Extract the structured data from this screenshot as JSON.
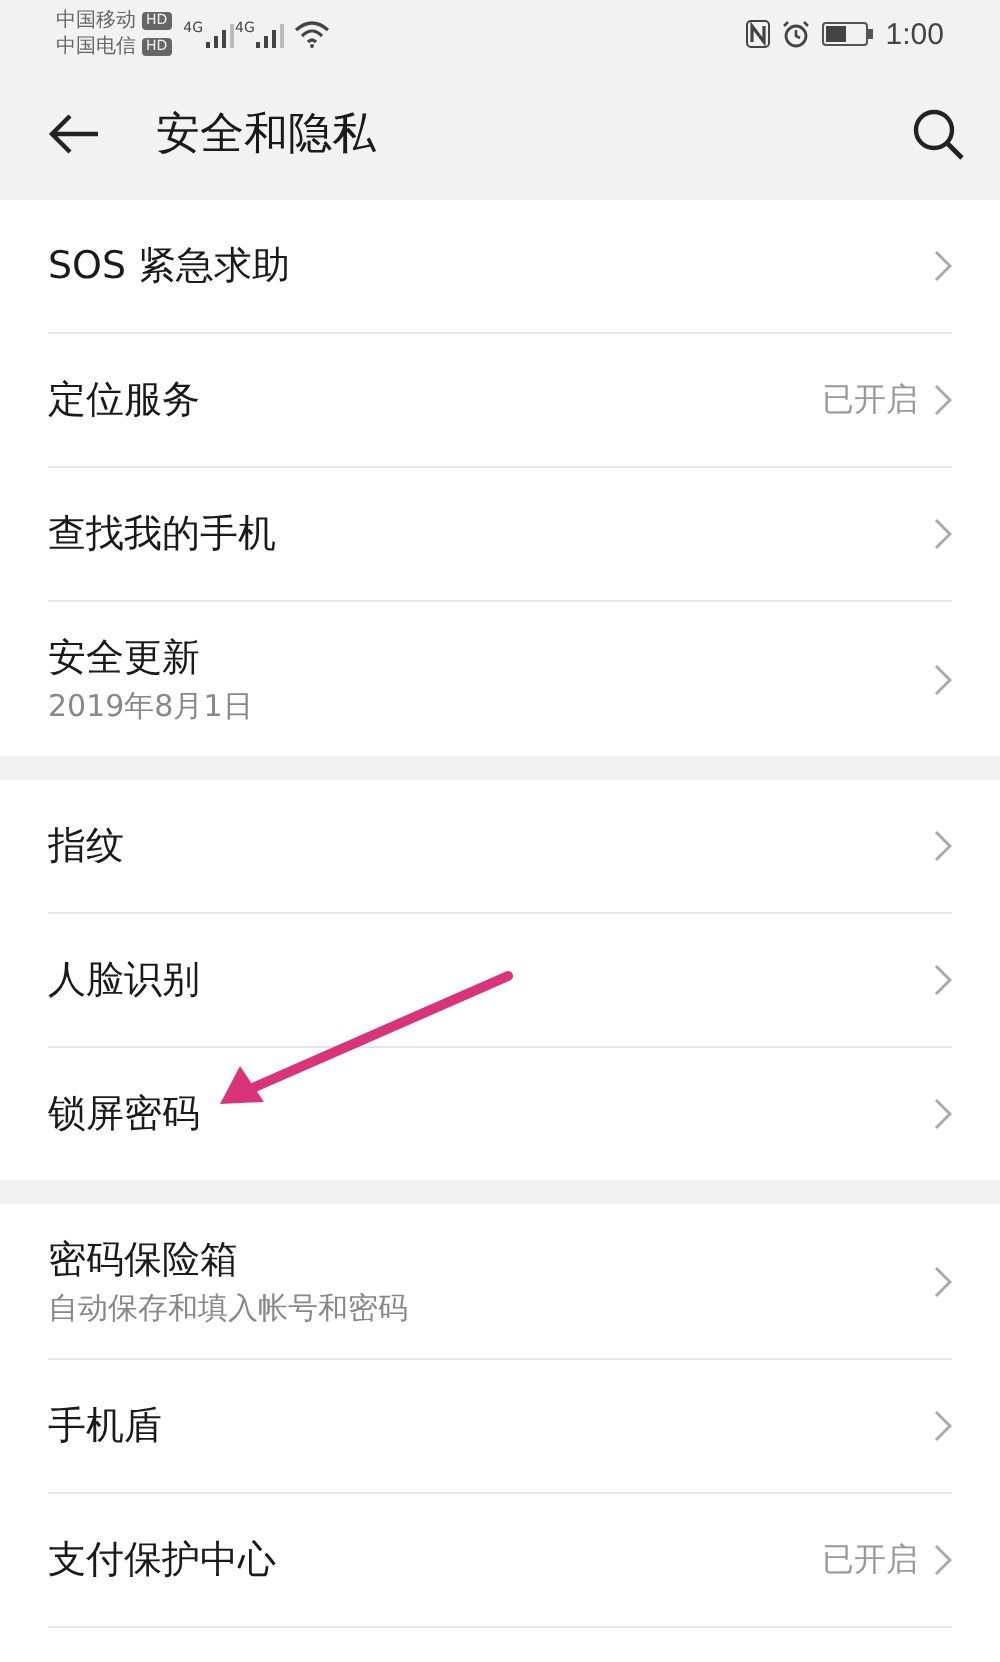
{
  "status_bar": {
    "carriers": [
      {
        "name": "中国移动",
        "badge": "HD",
        "network": "4G"
      },
      {
        "name": "中国电信",
        "badge": "HD",
        "network": "4G"
      }
    ],
    "time": "1:00"
  },
  "header": {
    "title": "安全和隐私"
  },
  "groups": [
    {
      "items": [
        {
          "title": "SOS 紧急求助"
        },
        {
          "title": "定位服务",
          "value": "已开启"
        },
        {
          "title": "查找我的手机"
        },
        {
          "title": "安全更新",
          "subtitle": "2019年8月1日"
        }
      ]
    },
    {
      "items": [
        {
          "title": "指纹"
        },
        {
          "title": "人脸识别"
        },
        {
          "title": "锁屏密码"
        }
      ]
    },
    {
      "items": [
        {
          "title": "密码保险箱",
          "subtitle": "自动保存和填入帐号和密码"
        },
        {
          "title": "手机盾"
        },
        {
          "title": "支付保护中心",
          "value": "已开启"
        }
      ]
    }
  ]
}
